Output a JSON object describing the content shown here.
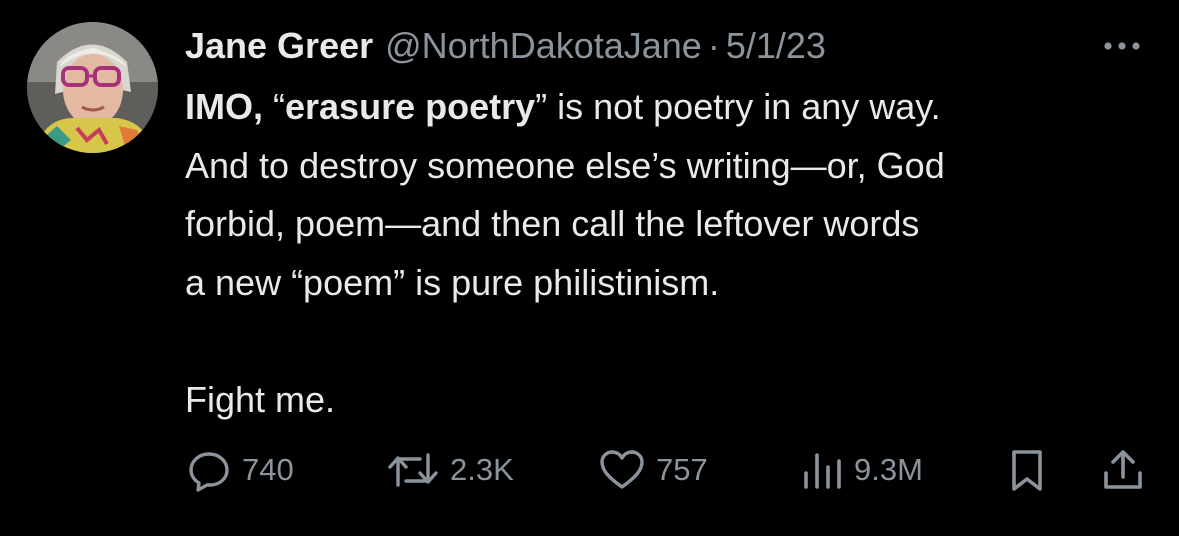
{
  "author": {
    "display_name": "Jane Greer",
    "handle": "@NorthDakotaJane",
    "separator": "·",
    "date": "5/1/23",
    "avatar_icon": "profile-photo"
  },
  "tweet": {
    "segments": {
      "imo": "IMO, ",
      "quote_open": "“",
      "bold_phrase": "erasure poetry",
      "line1_rest": "” is not poetry in any way.",
      "line2": "And to destroy someone else’s writing—or, God",
      "line3": "forbid, poem—and then call the leftover words",
      "line4": "a new “poem” is pure philistinism.",
      "line5": "Fight me."
    }
  },
  "actions": {
    "reply": {
      "icon": "reply-bubble-icon",
      "count": "740"
    },
    "retweet": {
      "icon": "retweet-icon",
      "count": "2.3K"
    },
    "like": {
      "icon": "heart-icon",
      "count": "757"
    },
    "views": {
      "icon": "views-bar-chart-icon",
      "count": "9.3M"
    },
    "bookmark": {
      "icon": "bookmark-icon"
    },
    "share": {
      "icon": "share-upload-icon"
    },
    "more": {
      "icon": "more-dots-icon"
    }
  },
  "colors": {
    "background": "#000000",
    "primary_text": "#e7e9ea",
    "secondary_text": "#8b949c"
  }
}
